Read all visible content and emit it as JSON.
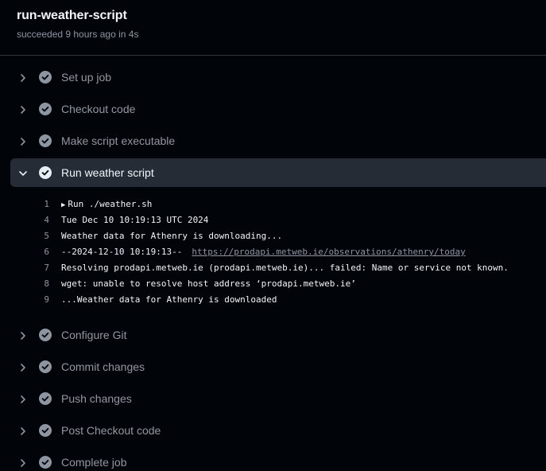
{
  "job": {
    "title": "run-weather-script",
    "subtitle": "succeeded 9 hours ago in 4s"
  },
  "icons": {
    "collapsed": "chevron-right-icon",
    "expanded": "chevron-down-icon",
    "status": "check-circle-icon"
  },
  "colors": {
    "success_circle": "#8d96a0",
    "expanded_background": "#262c36"
  },
  "steps_before": [
    {
      "label": "Set up job"
    },
    {
      "label": "Checkout code"
    },
    {
      "label": "Make script executable"
    }
  ],
  "expanded_step": {
    "label": "Run weather script",
    "log": [
      {
        "num": "1",
        "marker": "▶",
        "text": "Run ./weather.sh"
      },
      {
        "num": "4",
        "text": "Tue Dec 10 10:19:13 UTC 2024"
      },
      {
        "num": "5",
        "text": "Weather data for Athenry is downloading..."
      },
      {
        "num": "6",
        "text": "--2024-12-10 10:19:13--",
        "url": "https://prodapi.metweb.ie/observations/athenry/today"
      },
      {
        "num": "7",
        "text": "Resolving prodapi.metweb.ie (prodapi.metweb.ie)... failed: Name or service not known."
      },
      {
        "num": "8",
        "text": "wget: unable to resolve host address ‘prodapi.metweb.ie’"
      },
      {
        "num": "9",
        "text": "...Weather data for Athenry is downloaded"
      }
    ]
  },
  "steps_after": [
    {
      "label": "Configure Git"
    },
    {
      "label": "Commit changes"
    },
    {
      "label": "Push changes"
    },
    {
      "label": "Post Checkout code"
    },
    {
      "label": "Complete job"
    }
  ]
}
